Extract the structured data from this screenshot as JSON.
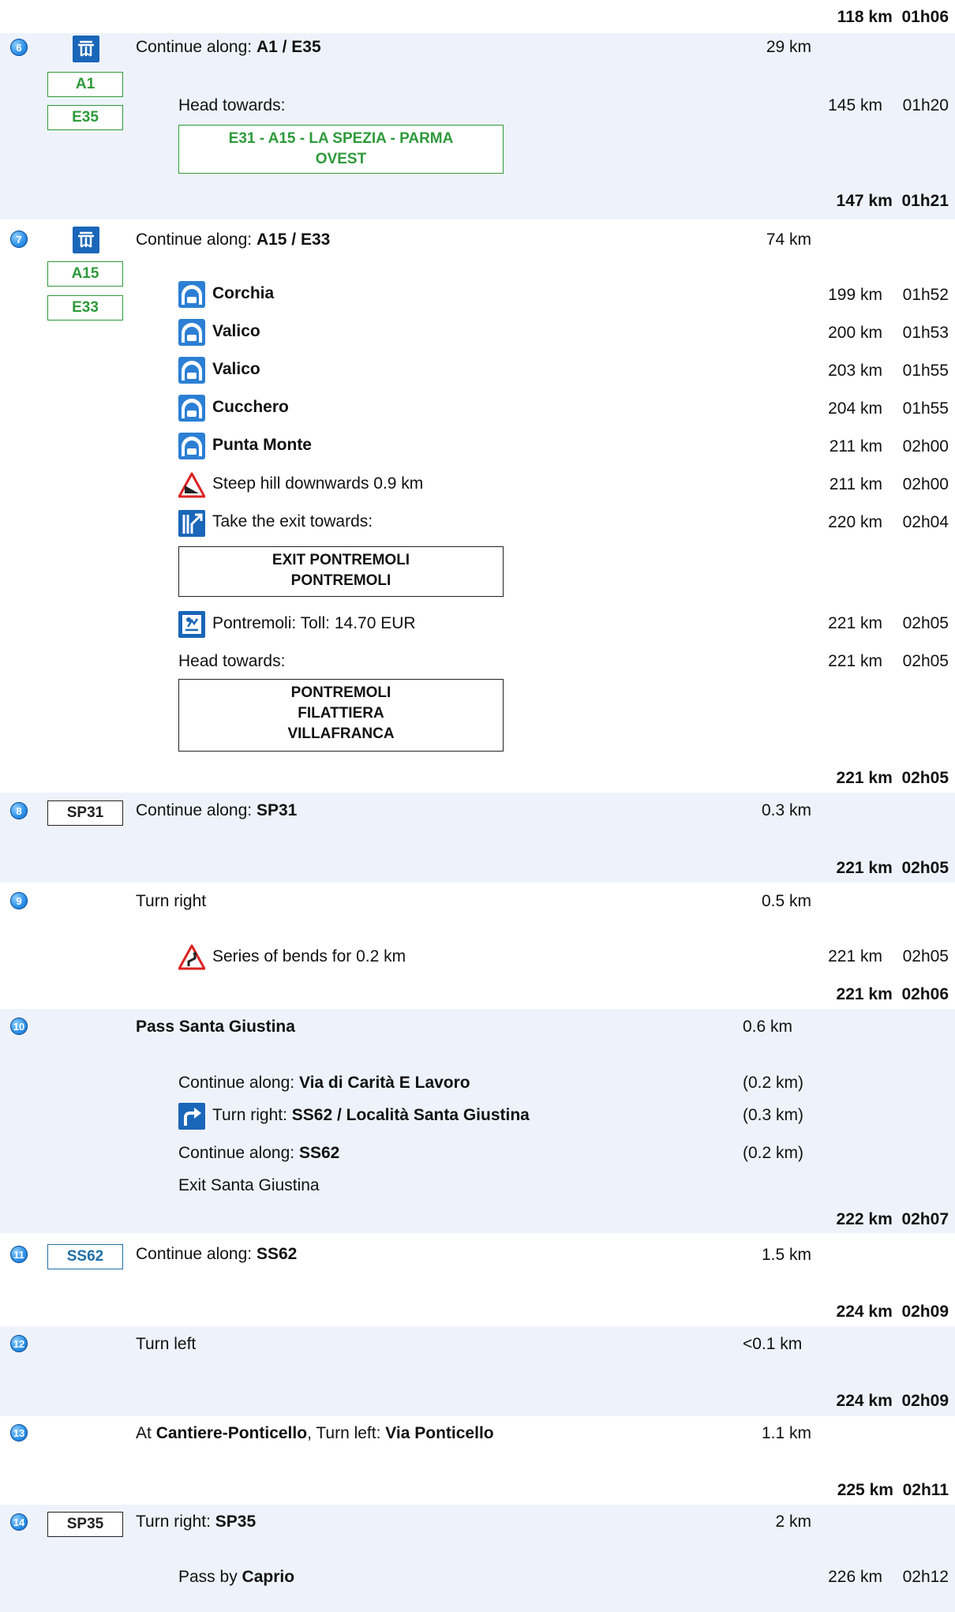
{
  "steps": {
    "top_total": {
      "km": "118 km",
      "time": "01h06"
    },
    "s6": {
      "num": "6",
      "badges": [
        "A1",
        "E35"
      ],
      "label": "Continue along: ",
      "road": "A1 / E35",
      "dist": "29 km",
      "head": "Head towards:",
      "head_km": "145 km",
      "head_time": "01h20",
      "sign": [
        "E31 - A15 - LA SPEZIA - PARMA",
        "OVEST"
      ],
      "total": {
        "km": "147 km",
        "time": "01h21"
      }
    },
    "s7": {
      "num": "7",
      "badges": [
        "A15",
        "E33"
      ],
      "label": "Continue along: ",
      "road": "A15 / E33",
      "dist": "74 km",
      "tunnels": [
        {
          "name": "Corchia",
          "km": "199 km",
          "time": "01h52"
        },
        {
          "name": "Valico",
          "km": "200 km",
          "time": "01h53"
        },
        {
          "name": "Valico",
          "km": "203 km",
          "time": "01h55"
        },
        {
          "name": "Cucchero",
          "km": "204 km",
          "time": "01h55"
        },
        {
          "name": "Punta Monte",
          "km": "211 km",
          "time": "02h00"
        }
      ],
      "hill": {
        "text": "Steep hill downwards 0.9 km",
        "km": "211 km",
        "time": "02h00"
      },
      "exit": {
        "text": "Take the exit towards:",
        "km": "220 km",
        "time": "02h04"
      },
      "exit_sign": [
        "EXIT PONTREMOLI",
        "PONTREMOLI"
      ],
      "toll": {
        "text": "Pontremoli: Toll: 14.70 EUR",
        "km": "221 km",
        "time": "02h05"
      },
      "head": {
        "text": "Head towards:",
        "km": "221 km",
        "time": "02h05"
      },
      "head_sign": [
        "PONTREMOLI",
        "FILATTIERA",
        "VILLAFRANCA"
      ],
      "total": {
        "km": "221 km",
        "time": "02h05"
      }
    },
    "s8": {
      "num": "8",
      "badge": "SP31",
      "label": "Continue along: ",
      "road": "SP31",
      "dist": "0.3 km",
      "total": {
        "km": "221 km",
        "time": "02h05"
      }
    },
    "s9": {
      "num": "9",
      "text": "Turn right",
      "dist": "0.5 km",
      "bends": {
        "text": "Series of bends for 0.2 km",
        "km": "221 km",
        "time": "02h05"
      },
      "total": {
        "km": "221 km",
        "time": "02h06"
      }
    },
    "s10": {
      "num": "10",
      "text": "Pass Santa Giustina",
      "dist": "0.6 km",
      "sub1": {
        "label": "Continue along: ",
        "road": "Via di Carità E Lavoro",
        "dist": "(0.2 km)"
      },
      "sub2": {
        "label": "Turn right: ",
        "road": "SS62 / Località Santa Giustina",
        "dist": "(0.3 km)"
      },
      "sub3": {
        "label": "Continue along: ",
        "road": "SS62",
        "dist": "(0.2 km)"
      },
      "sub4": "Exit Santa Giustina",
      "total": {
        "km": "222 km",
        "time": "02h07"
      }
    },
    "s11": {
      "num": "11",
      "badge": "SS62",
      "label": "Continue along: ",
      "road": "SS62",
      "dist": "1.5 km",
      "total": {
        "km": "224 km",
        "time": "02h09"
      }
    },
    "s12": {
      "num": "12",
      "text": "Turn left",
      "dist": "<0.1 km",
      "total": {
        "km": "224 km",
        "time": "02h09"
      }
    },
    "s13": {
      "num": "13",
      "pre": "At ",
      "place": "Cantiere-Ponticello",
      "mid": ", Turn left: ",
      "road": "Via Ponticello",
      "dist": "1.1 km",
      "total": {
        "km": "225 km",
        "time": "02h11"
      }
    },
    "s14": {
      "num": "14",
      "badge": "SP35",
      "label": "Turn right: ",
      "road": "SP35",
      "dist": "2 km",
      "pass_label": "Pass by ",
      "pass_place": "Caprio",
      "pass_km": "226 km",
      "pass_time": "02h12"
    }
  },
  "colors": {
    "band": "#eef3fb",
    "green": "#2e9a3a",
    "blue": "#1f6fa8"
  }
}
